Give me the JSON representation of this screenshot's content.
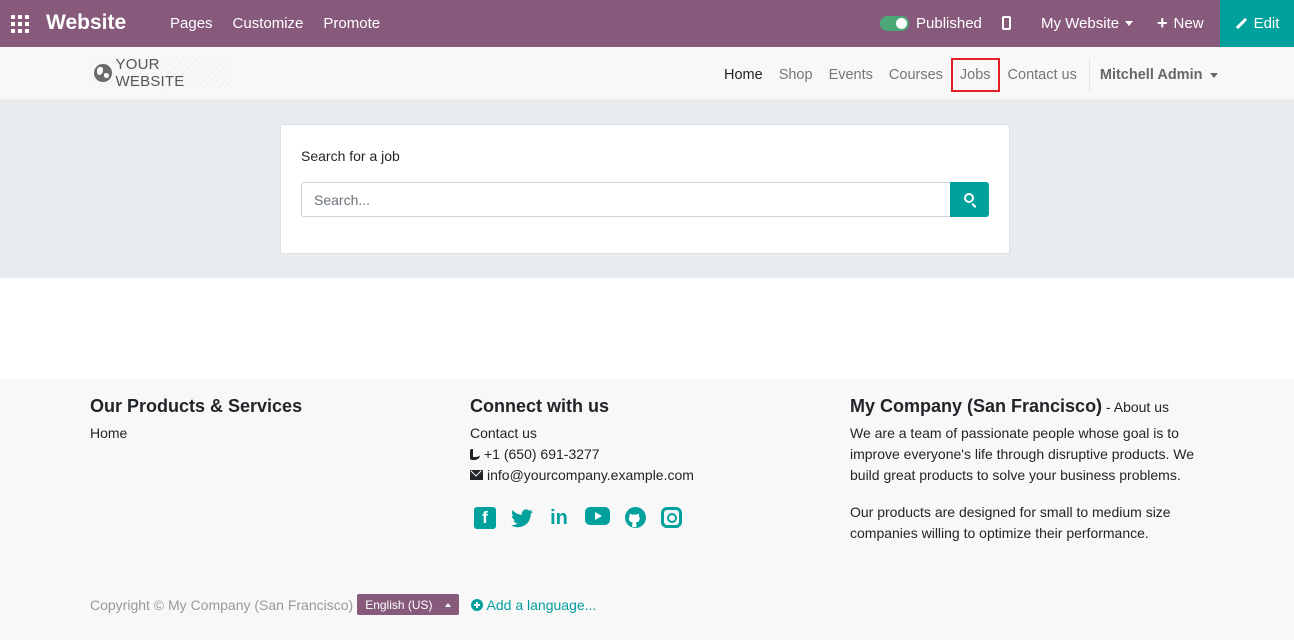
{
  "admin_bar": {
    "brand": "Website",
    "menu": [
      "Pages",
      "Customize",
      "Promote"
    ],
    "published_label": "Published",
    "website_selector": "My Website",
    "new_label": "New",
    "edit_label": "Edit"
  },
  "site_header": {
    "logo_text": "YOUR WEBSITE",
    "nav": [
      "Home",
      "Shop",
      "Events",
      "Courses",
      "Jobs",
      "Contact us"
    ],
    "user": "Mitchell Admin"
  },
  "search": {
    "title": "Search for a job",
    "placeholder": "Search..."
  },
  "footer": {
    "products": {
      "heading": "Our Products & Services",
      "link": "Home"
    },
    "connect": {
      "heading": "Connect with us",
      "contact_link": "Contact us",
      "phone": "+1 (650) 691-3277",
      "email": "info@yourcompany.example.com",
      "social_icons": [
        "facebook-icon",
        "twitter-icon",
        "linkedin-icon",
        "youtube-icon",
        "github-icon",
        "instagram-icon"
      ]
    },
    "company": {
      "heading": "My Company (San Francisco)",
      "separator": " - ",
      "about_link": "About us",
      "para1": "We are a team of passionate people whose goal is to improve everyone's life through disruptive products. We build great products to solve your business problems.",
      "para2": "Our products are designed for small to medium size companies willing to optimize their performance."
    },
    "copyright": "Copyright © My Company (San Francisco)",
    "language": "English (US)",
    "add_language": "Add a language..."
  },
  "colors": {
    "admin_bar": "#875a7b",
    "accent": "#00a09d",
    "highlight_border": "#e41e26"
  }
}
